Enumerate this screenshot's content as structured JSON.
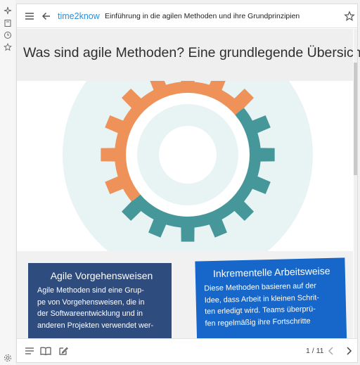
{
  "header": {
    "brand": "time2know",
    "course_title": "Einführung in die agilen Methoden und ihre Grundprinzipien"
  },
  "page": {
    "title": "Was sind agile Methoden? Eine grundlegende Übersicht"
  },
  "hero": {
    "colors": {
      "orange": "#ee9259",
      "teal": "#45979a",
      "pale": "#e8f3f4"
    }
  },
  "cards": [
    {
      "title": "Agile Vorgehensweisen",
      "lines": [
        "Agile Methoden sind eine Grup-",
        "pe von Vorgehensweisen, die in",
        "der Softwareentwicklung und in",
        "anderen Projekten verwendet wer-"
      ],
      "color": "#2f4c7e"
    },
    {
      "title": "Inkrementelle Arbeitsweise",
      "lines": [
        "Diese Methoden basieren auf der",
        "Idee, dass Arbeit in kleinen Schrit-",
        "ten erledigt wird. Teams überprü-",
        "fen regelmäßig ihre Fortschritte"
      ],
      "color": "#1667c9"
    }
  ],
  "footer": {
    "pager": "1 / 11"
  },
  "icons": {
    "rail": [
      "sparkle-icon",
      "book-icon",
      "clock-icon",
      "star-icon",
      "settings-icon"
    ],
    "top": [
      "menu-icon",
      "back-arrow-icon",
      "bookmark-star-icon"
    ],
    "bottom": [
      "list-icon",
      "open-book-icon",
      "edit-icon",
      "prev-page-icon",
      "next-page-icon"
    ]
  }
}
